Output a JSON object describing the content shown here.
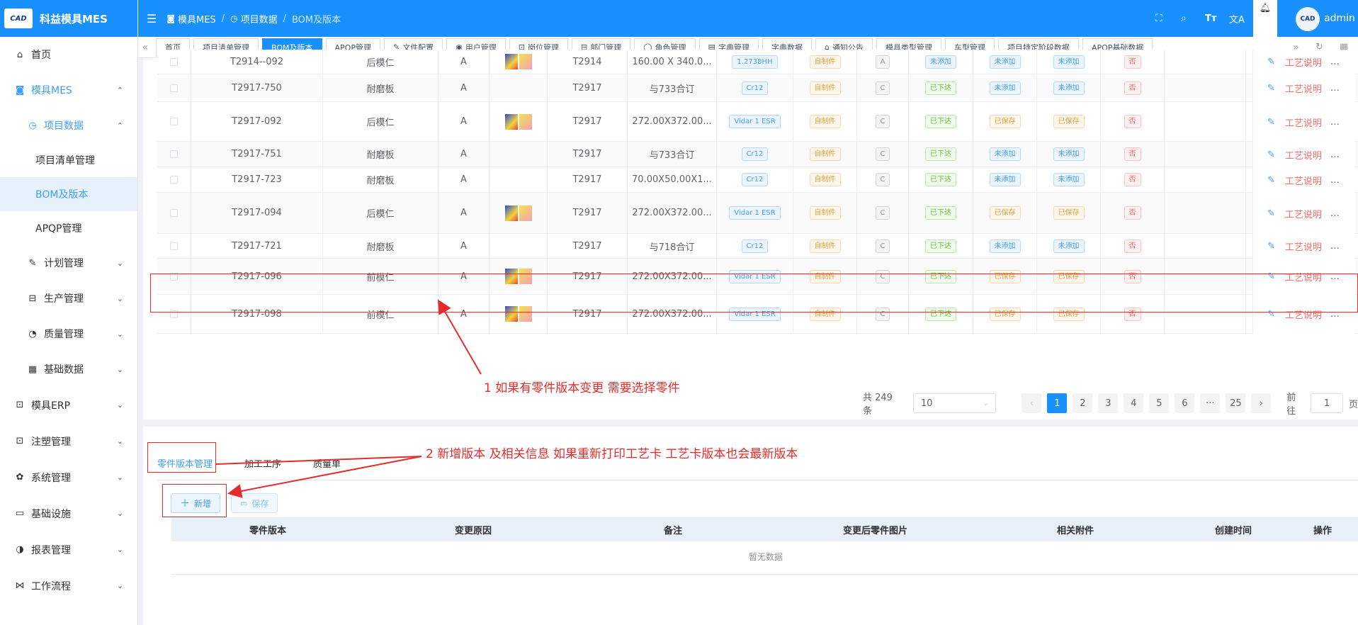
{
  "logo": {
    "text": "科益模具MES",
    "badge": "CAD"
  },
  "sidebar": {
    "items": [
      {
        "label": "首页",
        "icon": "home-icon"
      },
      {
        "label": "模具MES",
        "icon": "camera-icon"
      },
      {
        "label": "项目数据",
        "icon": "clock-icon"
      },
      {
        "label": "项目清单管理"
      },
      {
        "label": "BOM及版本"
      },
      {
        "label": "APQP管理"
      },
      {
        "label": "计划管理",
        "icon": "edit-icon"
      },
      {
        "label": "生产管理",
        "icon": "gift-icon"
      },
      {
        "label": "质量管理",
        "icon": "timer-icon"
      },
      {
        "label": "基础数据",
        "icon": "calendar-icon"
      },
      {
        "label": "模具ERP",
        "icon": "bag-icon"
      },
      {
        "label": "注塑管理",
        "icon": "bag-icon"
      },
      {
        "label": "系统管理",
        "icon": "gear-icon"
      },
      {
        "label": "基础设施",
        "icon": "monitor-icon"
      },
      {
        "label": "报表管理",
        "icon": "pie-icon"
      },
      {
        "label": "工作流程",
        "icon": "flow-icon"
      }
    ]
  },
  "header": {
    "breadcrumb": [
      "模具MES",
      "项目数据",
      "BOM及版本"
    ],
    "user": "admin"
  },
  "tabs": [
    "首页",
    "项目清单管理",
    "BOM及版本",
    "APQP管理",
    "文件配置",
    "用户管理",
    "岗位管理",
    "部门管理",
    "角色管理",
    "字典管理",
    "字典数据",
    "通知公告",
    "模具类型管理",
    "车型管理",
    "项目特定阶段数据",
    "APQP基础数据"
  ],
  "rows": [
    {
      "code": "T2914--092",
      "name": "后模仁",
      "ver": "A",
      "img": true,
      "proj": "T2914",
      "size": "160.00 X 340.0...",
      "mat": "1.2738HH",
      "src": "自制件",
      "grade": "A",
      "s1": "未添加",
      "s2": "未添加",
      "s3": "未添加",
      "flag": "否"
    },
    {
      "code": "T2917-750",
      "name": "耐磨板",
      "ver": "A",
      "img": false,
      "proj": "T2917",
      "size": "与733合订",
      "mat": "Cr12",
      "src": "自制件",
      "grade": "C",
      "s1": "已下达",
      "s2": "未添加",
      "s3": "未添加",
      "flag": "否"
    },
    {
      "code": "T2917-092",
      "name": "后模仁",
      "ver": "A",
      "img": true,
      "proj": "T2917",
      "size": "272.00X372.00...",
      "mat": "Vidar 1 ESR",
      "src": "自制件",
      "grade": "C",
      "s1": "已下达",
      "s2": "已保存",
      "s3": "已保存",
      "flag": "否"
    },
    {
      "code": "T2917-751",
      "name": "耐磨板",
      "ver": "A",
      "img": false,
      "proj": "T2917",
      "size": "与733合订",
      "mat": "Cr12",
      "src": "自制件",
      "grade": "C",
      "s1": "已下达",
      "s2": "未添加",
      "s3": "未添加",
      "flag": "否"
    },
    {
      "code": "T2917-723",
      "name": "耐磨板",
      "ver": "A",
      "img": false,
      "proj": "T2917",
      "size": "70.00X50.00X1...",
      "mat": "Cr12",
      "src": "自制件",
      "grade": "C",
      "s1": "已下达",
      "s2": "未添加",
      "s3": "未添加",
      "flag": "否"
    },
    {
      "code": "T2917-094",
      "name": "后模仁",
      "ver": "A",
      "img": true,
      "proj": "T2917",
      "size": "272.00X372.00...",
      "mat": "Vidar 1 ESR",
      "src": "自制件",
      "grade": "C",
      "s1": "已下达",
      "s2": "已保存",
      "s3": "已保存",
      "flag": "否"
    },
    {
      "code": "T2917-721",
      "name": "耐磨板",
      "ver": "A",
      "img": false,
      "proj": "T2917",
      "size": "与718合订",
      "mat": "Cr12",
      "src": "自制件",
      "grade": "C",
      "s1": "已下达",
      "s2": "未添加",
      "s3": "未添加",
      "flag": "否"
    },
    {
      "code": "T2917-096",
      "name": "前模仁",
      "ver": "A",
      "img": true,
      "proj": "T2917",
      "size": "272.00X372.00...",
      "mat": "Vidar 1 ESR",
      "src": "自制件",
      "grade": "C",
      "s1": "已下达",
      "s2": "已保存",
      "s3": "已保存",
      "flag": "否"
    },
    {
      "code": "T2917-098",
      "name": "前模仁",
      "ver": "A",
      "img": true,
      "proj": "T2917",
      "size": "272.00X372.00...",
      "mat": "Vidar 1 ESR",
      "src": "自制件",
      "grade": "C",
      "s1": "已下达",
      "s2": "已保存",
      "s3": "已保存",
      "flag": "否"
    }
  ],
  "row_action": "工艺说明",
  "pager": {
    "total": "共 249 条",
    "size": "10",
    "pages": [
      "1",
      "2",
      "3",
      "4",
      "5",
      "6",
      "···",
      "25"
    ],
    "goto": "前往",
    "page_input": "1",
    "page_unit": "页"
  },
  "annotations": {
    "a1": "1 如果有零件版本变更 需要选择零件",
    "a2": "2 新增版本 及相关信息  如果重新打印工艺卡 工艺卡版本也会最新版本"
  },
  "bottom": {
    "tabs": [
      "零件版本管理",
      "加工工序",
      "质量单"
    ],
    "add": "新增",
    "save": "保存",
    "columns": [
      "零件版本",
      "变更原因",
      "备注",
      "变更后零件图片",
      "相关附件",
      "创建时间",
      "操作"
    ],
    "empty": "暂无数据"
  },
  "colors": {
    "primary": "#1890ff",
    "annotation": "#e52b2b"
  }
}
